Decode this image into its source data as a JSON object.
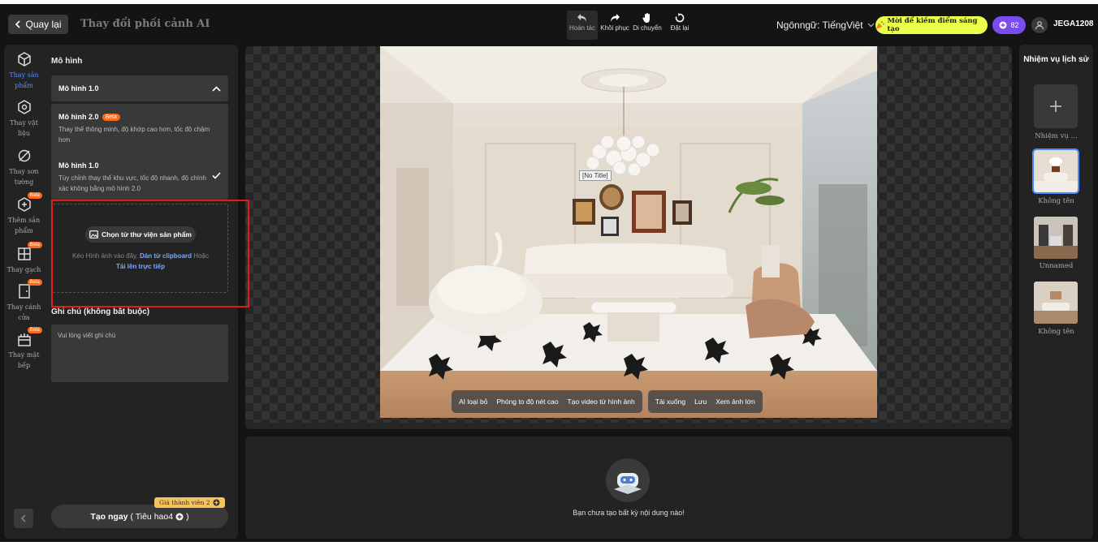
{
  "header": {
    "back_label": "Quay lại",
    "title": "Thay đổi phối cảnh AI",
    "tools": [
      {
        "label": "Hoàn tác",
        "icon": "undo-icon"
      },
      {
        "label": "Khôi phục",
        "icon": "redo-icon"
      },
      {
        "label": "Di chuyển",
        "icon": "hand-icon"
      },
      {
        "label": "Đặt lại",
        "icon": "reset-icon"
      }
    ],
    "language_label": "Ngônngữ: TiếngViệt",
    "promo_label": "Mời để kiếm điểm sáng tạo",
    "points": "82",
    "username": "JEGA1208"
  },
  "rail": {
    "items": [
      {
        "label": "Thay sản phẩm",
        "icon": "product-cube-icon",
        "active": true
      },
      {
        "label": "Thay vật liệu",
        "icon": "material-cube-icon"
      },
      {
        "label": "Thay sơn tường",
        "icon": "paint-slash-icon"
      },
      {
        "label": "Thêm sản phẩm",
        "icon": "add-product-icon",
        "badge": "Beta"
      },
      {
        "label": "Thay gạch",
        "icon": "tile-icon",
        "badge": "Beta"
      },
      {
        "label": "Thay cánh cửa",
        "icon": "door-icon",
        "badge": "Beta"
      },
      {
        "label": "Thay mặt bếp",
        "icon": "kitchen-icon",
        "badge": "Beta"
      }
    ]
  },
  "panel": {
    "model_section_label": "Mô hình",
    "selected_model": "Mô hình 1.0",
    "models": [
      {
        "name": "Mô hình 2.0",
        "badge": "Beta",
        "desc": "Thay thế thông minh, độ khớp cao hơn, tốc độ chậm hơn"
      },
      {
        "name": "Mô hình 1.0",
        "desc": "Tùy chỉnh thay thế khu vực, tốc độ nhanh, độ chính xác không bằng mô hình 2.0"
      }
    ],
    "upload": {
      "button_label": "Chọn từ thư viện sản phẩm",
      "hint_prefix": "Kéo Hình ảnh vào đây,",
      "hint_paste": "Dán từ clipboard",
      "hint_or": "Hoặc",
      "hint_upload": "Tải lên trực tiếp"
    },
    "note_label": "Ghi chú (không bắt buộc)",
    "note_placeholder": "Vui lòng viết ghi chú",
    "price_tag": "Giá thành viên 2",
    "create_label": "Tạo ngay",
    "create_cost": "( Tiêu hao4",
    "create_cost_end": ")"
  },
  "canvas": {
    "image_label": "[No Title]",
    "actions_left": [
      "AI loại bỏ",
      "Phóng to độ nét cao",
      "Tạo video từ hình ảnh"
    ],
    "actions_right": [
      "Tải xuống",
      "Lưu",
      "Xem ảnh lớn"
    ]
  },
  "results": {
    "empty_text": "Bạn chưa tạo bất kỳ nội dung nào!"
  },
  "history": {
    "title": "Nhiệm vụ lịch sử",
    "new_task_label": "Nhiệm vụ ...",
    "items": [
      "Không tên",
      "Unnamed",
      "Không tên"
    ]
  },
  "colors": {
    "accent_blue": "#5a8cff",
    "promo_yellow": "#e9ff4a",
    "points_purple": "#7a4cf0",
    "beta_orange": "#ff6a1a",
    "highlight_red": "#e21b1b"
  }
}
